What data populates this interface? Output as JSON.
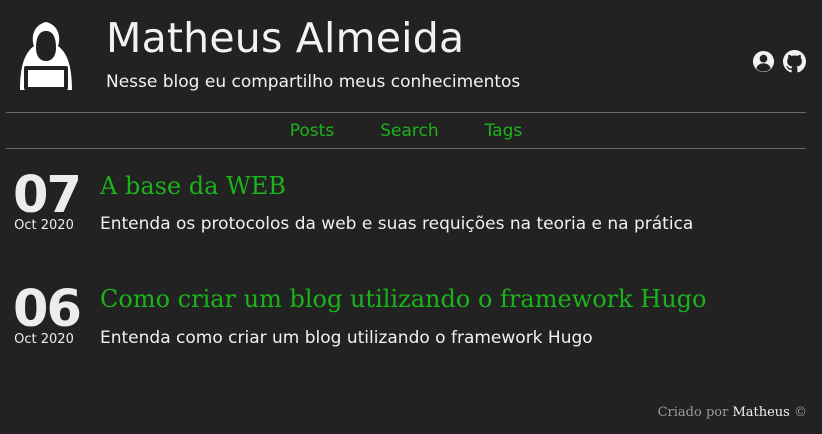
{
  "header": {
    "title": "Matheus Almeida",
    "subtitle": "Nesse blog eu compartilho meus conhecimentos",
    "avatar_icon": "hacker-avatar-icon",
    "social_icons": [
      "user-circle-icon",
      "github-icon"
    ]
  },
  "nav": {
    "items": [
      {
        "label": "Posts"
      },
      {
        "label": "Search"
      },
      {
        "label": "Tags"
      }
    ]
  },
  "posts": [
    {
      "day": "07",
      "month_year": "Oct 2020",
      "title": "A base da WEB",
      "summary": "Entenda os protocolos da web e suas requições na teoria e na prática"
    },
    {
      "day": "06",
      "month_year": "Oct 2020",
      "title": "Como criar um blog utilizando o framework Hugo",
      "summary": "Entenda como criar um blog utilizando o framework Hugo"
    }
  ],
  "footer": {
    "prefix": "Criado por",
    "author": "Matheus",
    "suffix": "©"
  },
  "colors": {
    "background": "#222222",
    "accent": "#1ab41a",
    "text": "#ececec",
    "divider": "#6a6a6a"
  }
}
